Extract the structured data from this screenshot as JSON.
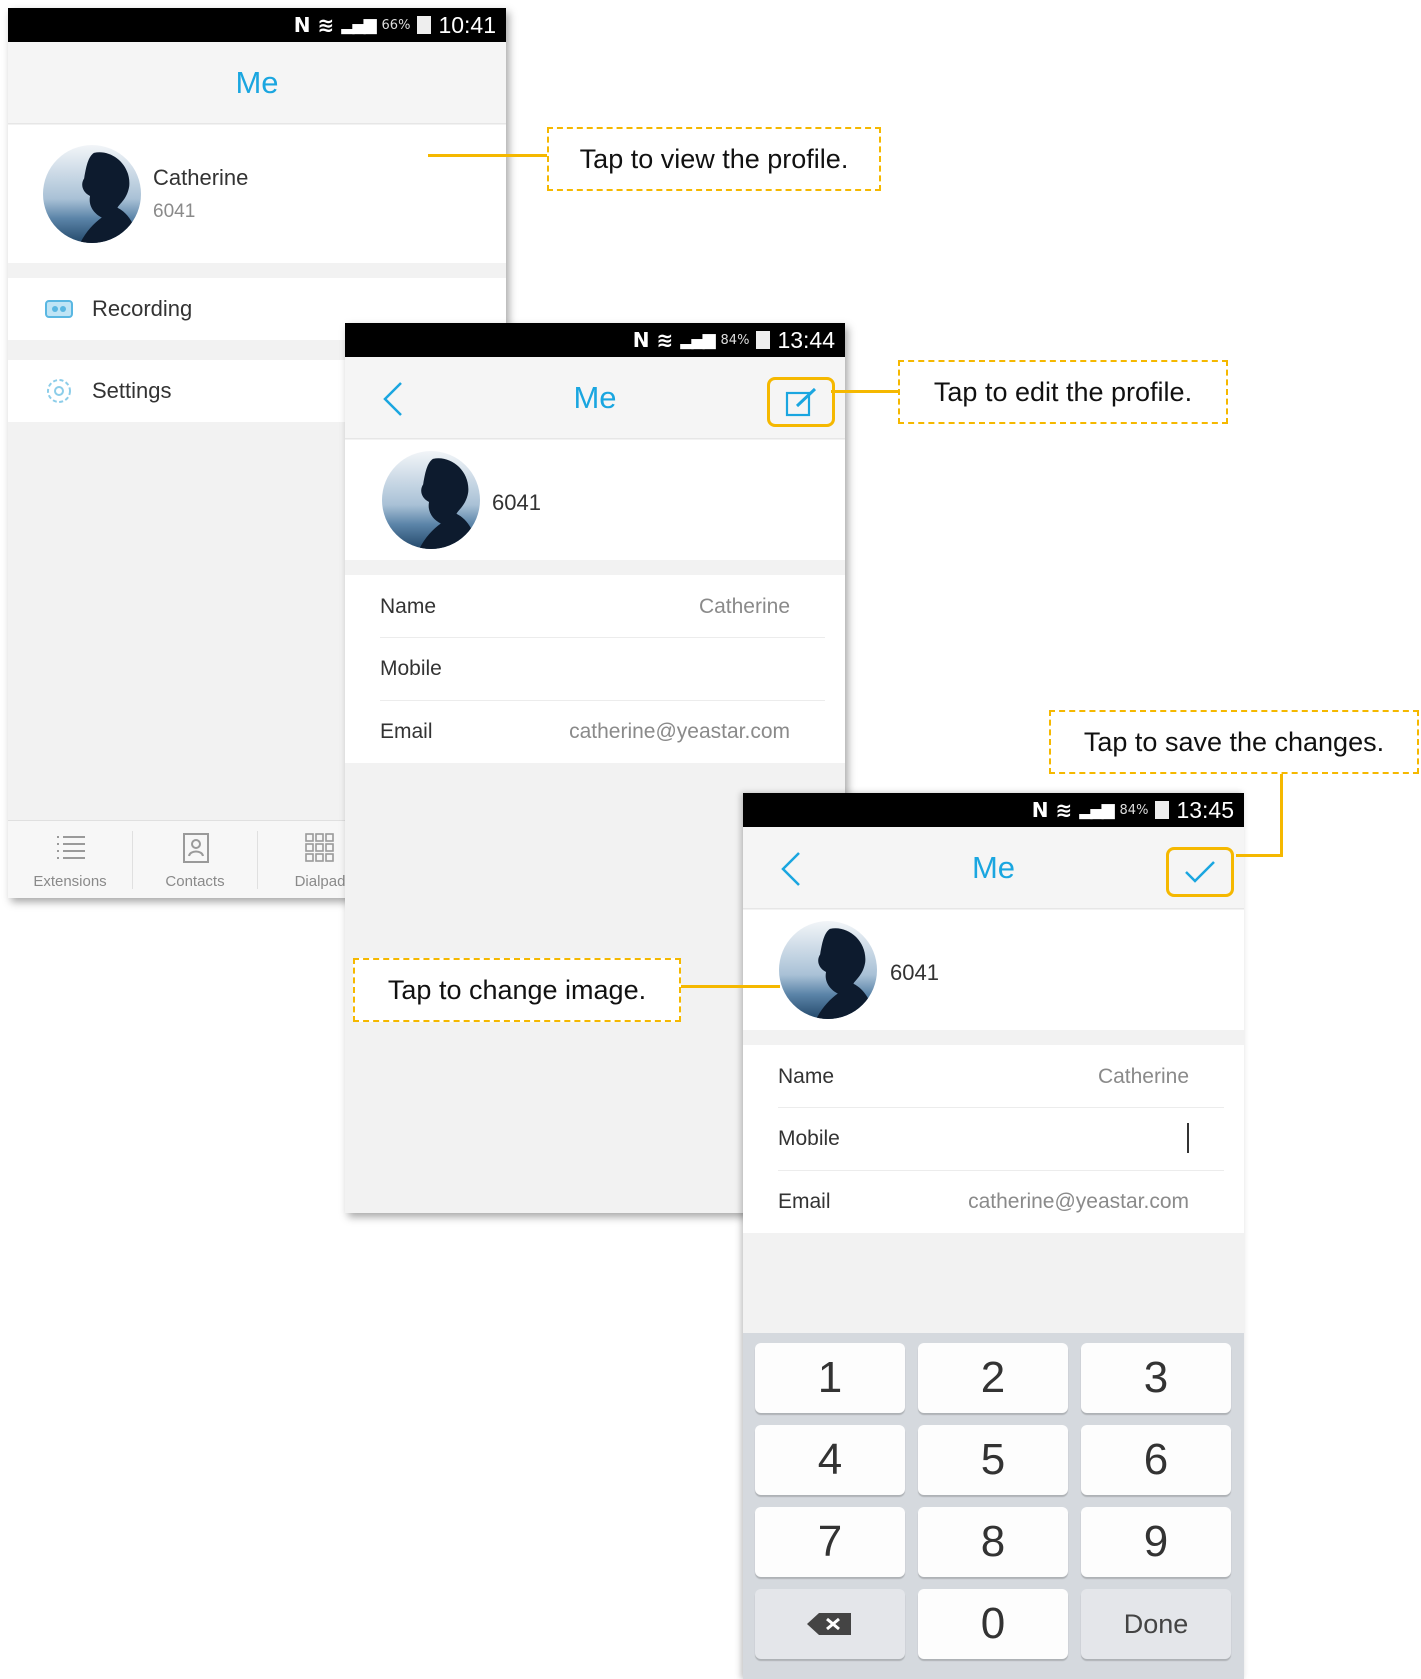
{
  "screen1": {
    "status": {
      "battery": "66%",
      "time": "10:41"
    },
    "title": "Me",
    "profile": {
      "name": "Catherine",
      "ext": "6041"
    },
    "menu": [
      {
        "label": "Recording",
        "icon": "recording-icon"
      },
      {
        "label": "Settings",
        "icon": "settings-icon"
      }
    ],
    "tabs": [
      {
        "label": "Extensions",
        "icon": "list-icon"
      },
      {
        "label": "Contacts",
        "icon": "contacts-book-icon"
      },
      {
        "label": "Dialpad",
        "icon": "dialpad-grid-icon"
      }
    ]
  },
  "screen2": {
    "status": {
      "battery": "84%",
      "time": "13:44"
    },
    "title": "Me",
    "ext": "6041",
    "fields": [
      {
        "label": "Name",
        "value": "Catherine"
      },
      {
        "label": "Mobile",
        "value": ""
      },
      {
        "label": "Email",
        "value": "catherine@yeastar.com"
      }
    ]
  },
  "screen3": {
    "status": {
      "battery": "84%",
      "time": "13:45"
    },
    "title": "Me",
    "ext": "6041",
    "fields": [
      {
        "label": "Name",
        "value": "Catherine"
      },
      {
        "label": "Mobile",
        "value": ""
      },
      {
        "label": "Email",
        "value": "catherine@yeastar.com"
      }
    ],
    "keypad": [
      "1",
      "2",
      "3",
      "4",
      "5",
      "6",
      "7",
      "8",
      "9",
      "",
      "0",
      "Done"
    ]
  },
  "callouts": {
    "view_profile": "Tap to view the profile.",
    "edit_profile": "Tap to edit the profile.",
    "save_changes": "Tap to save the changes.",
    "change_image": "Tap to change image."
  },
  "colors": {
    "accent": "#1aa6e0",
    "highlight": "#f5b800"
  }
}
